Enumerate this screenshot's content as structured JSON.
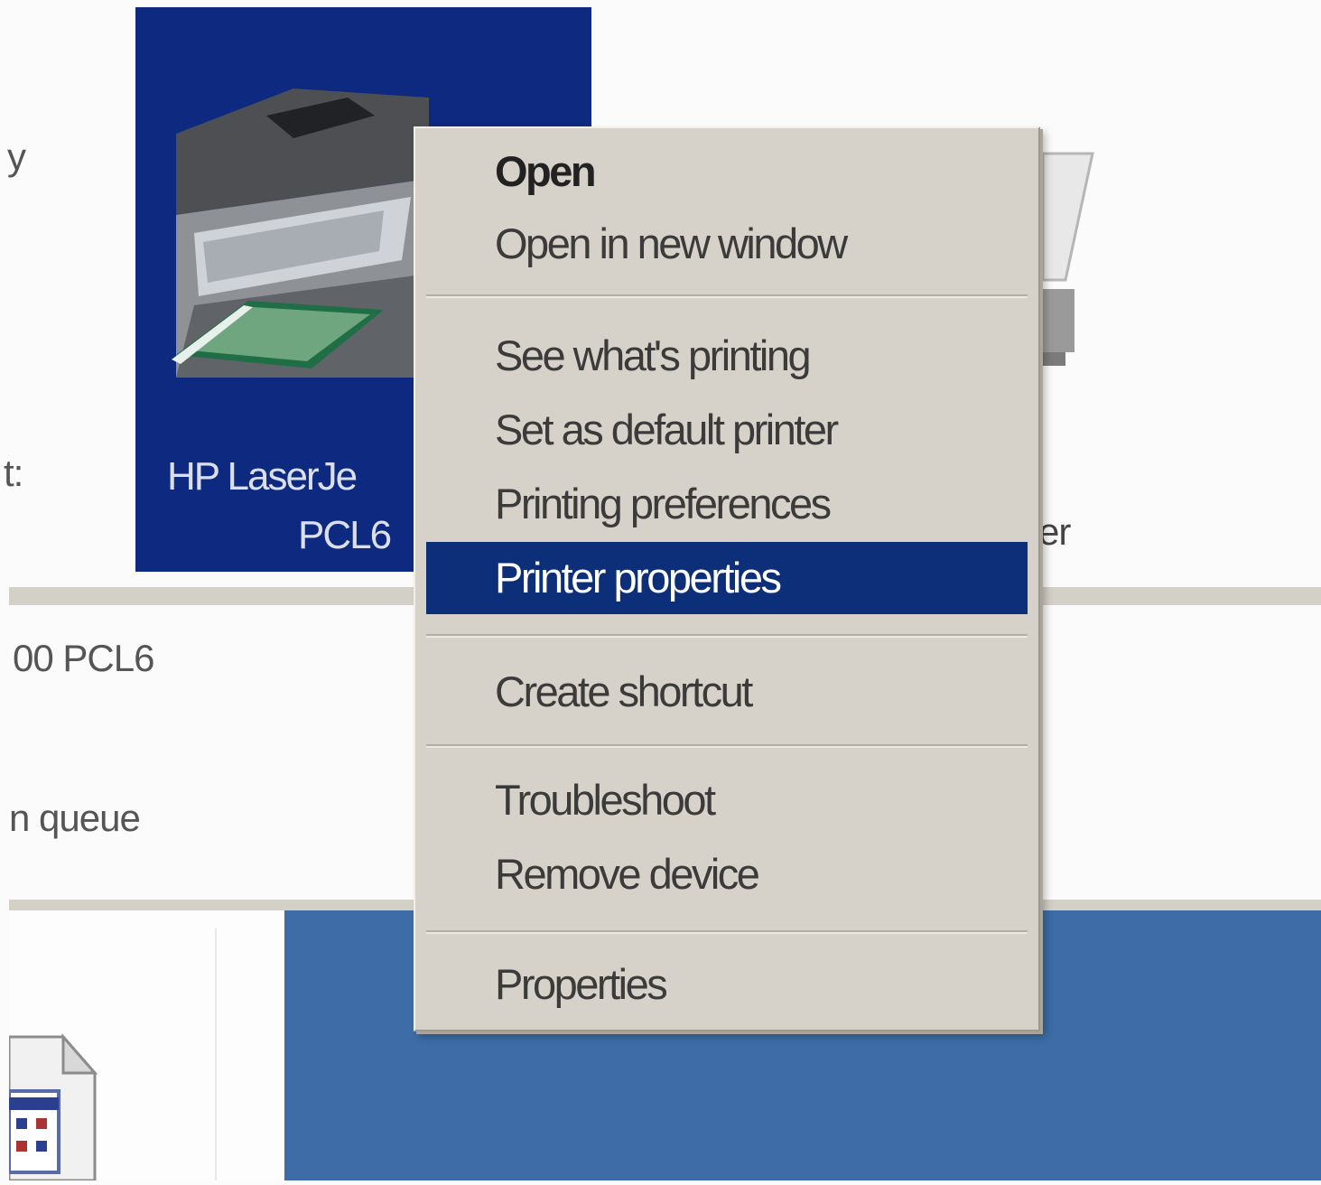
{
  "printer": {
    "name_line1": "HP LaserJe",
    "name_line2": "PCL6"
  },
  "left_fragments": {
    "model": "00 PCL6",
    "queue": "n queue",
    "top_partial": "y",
    "mid_partial": "t:"
  },
  "right_fragments": {
    "label_partial": "er"
  },
  "context_menu": {
    "items": [
      {
        "label": "Open",
        "bold": true
      },
      {
        "label": "Open in new window"
      },
      {
        "label": "See what's printing"
      },
      {
        "label": "Set as default printer"
      },
      {
        "label": "Printing preferences"
      },
      {
        "label": "Printer properties",
        "selected": true
      },
      {
        "label": "Create shortcut"
      },
      {
        "label": "Troubleshoot"
      },
      {
        "label": "Remove device"
      },
      {
        "label": "Properties"
      }
    ]
  },
  "colors": {
    "selection": "#0d2e78",
    "menu_bg": "#d6d2ca",
    "desktop_blue": "#3d6ca6"
  }
}
